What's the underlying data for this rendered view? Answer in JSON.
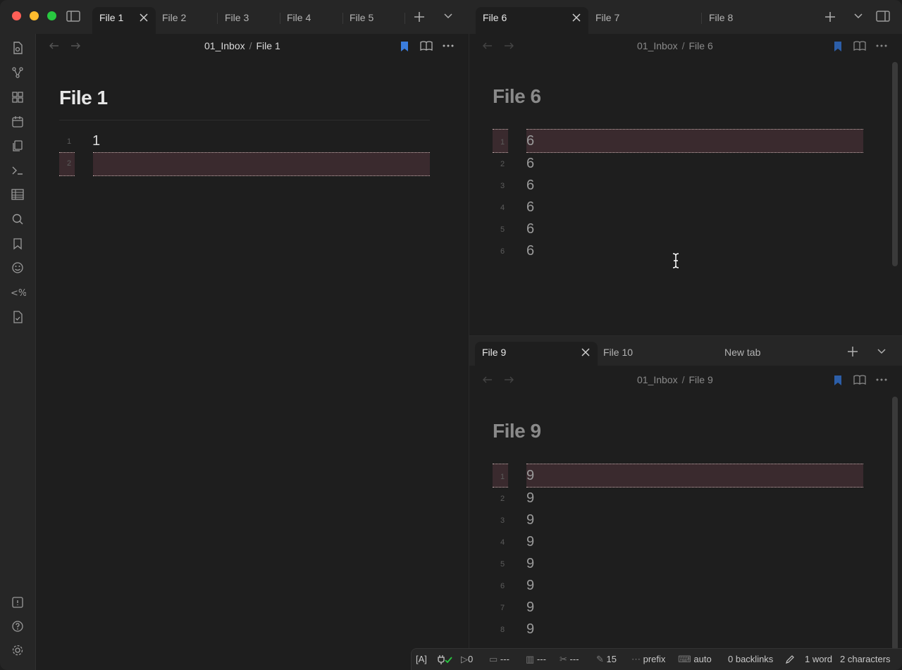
{
  "left_tabs": [
    "File 1",
    "File 2",
    "File 3",
    "File 4",
    "File 5"
  ],
  "right_top_tabs": [
    "File 6",
    "File 7",
    "File 8"
  ],
  "right_bottom_tabs": [
    "File 9",
    "File 10",
    "New tab"
  ],
  "pane1": {
    "breadcrumb_folder": "01_Inbox",
    "breadcrumb_sep": "/",
    "breadcrumb_file": "File 1",
    "title": "File 1",
    "line_numbers": [
      "1",
      "2"
    ],
    "lines": [
      "1",
      ""
    ]
  },
  "pane2": {
    "breadcrumb_folder": "01_Inbox",
    "breadcrumb_sep": "/",
    "breadcrumb_file": "File 6",
    "title": "File 6",
    "line_numbers": [
      "1",
      "2",
      "3",
      "4",
      "5",
      "6"
    ],
    "lines": [
      "6",
      "6",
      "6",
      "6",
      "6",
      "6"
    ]
  },
  "pane3": {
    "breadcrumb_folder": "01_Inbox",
    "breadcrumb_sep": "/",
    "breadcrumb_file": "File 9",
    "title": "File 9",
    "line_numbers": [
      "1",
      "2",
      "3",
      "4",
      "5",
      "6",
      "7",
      "8"
    ],
    "lines": [
      "9",
      "9",
      "9",
      "9",
      "9",
      "9",
      "9",
      "9"
    ]
  },
  "status": {
    "vim_mode": "[A]",
    "count": "0",
    "s1": "---",
    "s2": "---",
    "s3": "---",
    "s4": "15",
    "prefix": "prefix",
    "auto": "auto",
    "backlinks": "0 backlinks",
    "words": "1 word",
    "chars": "2 characters"
  },
  "colors": {
    "background": "#1e1e1e",
    "tabstrip": "#262626",
    "highlight": "#3a2a2e",
    "bookmark": "#3b7ddd",
    "close": "#ff5f57",
    "minimize": "#febc2e",
    "zoom": "#28c840"
  },
  "icons": {
    "ribbon": [
      "open-file-icon",
      "graph-icon",
      "canvas-icon",
      "calendar-icon",
      "copy-icon",
      "terminal-icon",
      "table-icon",
      "search-icon",
      "bookmark-icon",
      "emoji-icon",
      "template-icon",
      "checklist-icon",
      "help-vault-icon",
      "help-icon",
      "settings-icon"
    ]
  }
}
